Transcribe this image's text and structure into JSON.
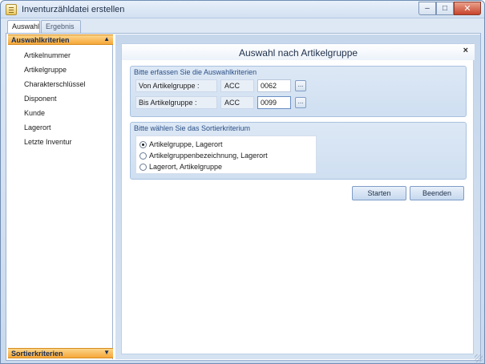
{
  "window": {
    "title": "Inventurzähldatei erstellen",
    "minimize_glyph": "–",
    "maximize_glyph": "□",
    "close_glyph": "✕"
  },
  "tabs": [
    {
      "label": "Auswahl",
      "active": true
    },
    {
      "label": "Ergebnis",
      "active": false
    }
  ],
  "sidebar": {
    "top_group": "Auswahlkriterien",
    "bottom_group": "Sortierkriterien",
    "items": [
      "Artikelnummer",
      "Artikelgruppe",
      "Charakterschlüssel",
      "Disponent",
      "Kunde",
      "Lagerort",
      "Letzte Inventur"
    ]
  },
  "panel": {
    "title": "Auswahl nach Artikelgruppe",
    "close_glyph": "×",
    "criteria": {
      "title": "Bitte erfassen Sie die Auswahlkriterien",
      "rows": [
        {
          "label": "Von Artikelgruppe :",
          "prefix": "ACC",
          "value": "0062",
          "button": "..."
        },
        {
          "label": "Bis Artikelgruppe :",
          "prefix": "ACC",
          "value": "0099",
          "button": "..."
        }
      ]
    },
    "sort": {
      "title": "Bitte wählen Sie das Sortierkriterium",
      "options": [
        {
          "label": "Artikelgruppe, Lagerort",
          "checked": true
        },
        {
          "label": "Artikelgruppenbezeichnung, Lagerort",
          "checked": false
        },
        {
          "label": "Lagerort, Artikelgruppe",
          "checked": false
        }
      ]
    },
    "buttons": {
      "start": "Starten",
      "end": "Beenden"
    }
  },
  "colors": {
    "accent_orange": "#f6a83a",
    "groupbox_blue": "#dde8f5",
    "title_text": "#2a4f86"
  }
}
